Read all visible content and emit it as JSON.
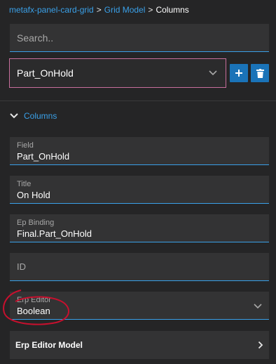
{
  "breadcrumb": {
    "items": [
      "metafx-panel-card-grid",
      "Grid Model",
      "Columns"
    ],
    "separator": ">"
  },
  "search": {
    "placeholder": "Search..",
    "value": ""
  },
  "column_select": {
    "value": "Part_OnHold"
  },
  "toolbar": {
    "add_icon": "plus-icon",
    "delete_icon": "trash-icon"
  },
  "section": {
    "title": "Columns",
    "expanded": true
  },
  "fields": {
    "field": {
      "label": "Field",
      "value": "Part_OnHold"
    },
    "title": {
      "label": "Title",
      "value": "On Hold"
    },
    "ep_binding": {
      "label": "Ep Binding",
      "value": "Final.Part_OnHold"
    },
    "id": {
      "placeholder": "ID",
      "value": ""
    },
    "erp_editor": {
      "label": "Erp Editor",
      "value": "Boolean"
    }
  },
  "erp_editor_model": {
    "label": "Erp Editor Model"
  },
  "colors": {
    "accent": "#3aa0e8",
    "button": "#1a73b8",
    "select_border": "#c76e9c",
    "annotation": "#c8102e",
    "background": "#252526",
    "field_background": "#333334"
  }
}
